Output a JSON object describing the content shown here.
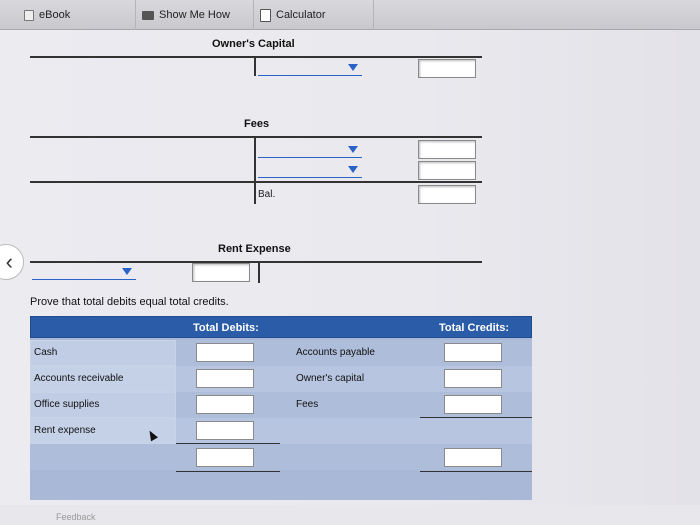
{
  "toolbar": {
    "ebook_label": "eBook",
    "show_me_how_label": "Show Me How",
    "calculator_label": "Calculator"
  },
  "t_accounts": {
    "owners_capital": {
      "title": "Owner's Capital"
    },
    "fees": {
      "title": "Fees",
      "balance_label": "Bal."
    },
    "rent_expense": {
      "title": "Rent Expense"
    }
  },
  "trial_balance": {
    "prompt": "Prove that total debits equal total credits.",
    "debit_header": "Total Debits:",
    "credit_header": "Total Credits:",
    "debit_accounts": [
      "Cash",
      "Accounts receivable",
      "Office supplies",
      "Rent expense"
    ],
    "credit_accounts": [
      "Accounts payable",
      "Owner's capital",
      "Fees"
    ]
  },
  "footer": {
    "feedback_label": "Feedback"
  },
  "icons": {
    "ebook": "book-icon",
    "show_me_how": "video-icon",
    "calculator": "calculator-icon",
    "back": "chevron-left-icon"
  },
  "colors": {
    "header_blue": "#2a5ca8",
    "row_blue": "#aebdda",
    "dropdown_blue": "#2a63c8"
  }
}
